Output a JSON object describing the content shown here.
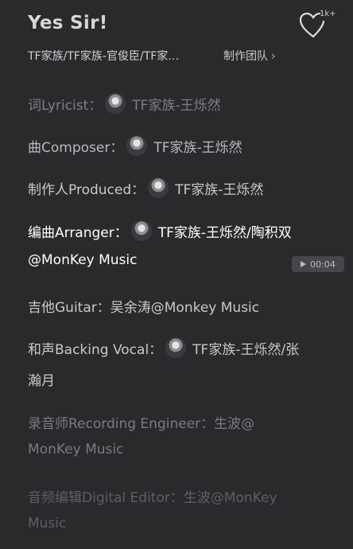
{
  "header": {
    "title": "Yes Sir!",
    "like_count": "1k+",
    "artists": "TF家族/TF家族-官俊臣/TF家…",
    "team_link": "制作团队",
    "team_chevron": "›"
  },
  "credits": [
    {
      "role": "词Lyricist：",
      "name": "TF家族-王烁然"
    },
    {
      "role": "曲Composer：",
      "name": "TF家族-王烁然"
    },
    {
      "role": "制作人Produced：",
      "name": "TF家族-王烁然"
    },
    {
      "role": "编曲Arranger：",
      "name": "TF家族-王烁然/陶积双",
      "cont": "@MonKey Music"
    },
    {
      "role": "吉他Guitar：",
      "name": "吴余涛@Monkey Music"
    },
    {
      "role": "和声Backing Vocal：",
      "name": "TF家族-王烁然/张",
      "cont": "瀚月"
    },
    {
      "role": "录音师Recording Engineer：",
      "name": "生波@",
      "cont": "MonKey Music"
    },
    {
      "role": "音频编辑Digital Editor：",
      "name": "生波@MonKey",
      "cont": "Music"
    }
  ],
  "player": {
    "time": "00:04"
  }
}
